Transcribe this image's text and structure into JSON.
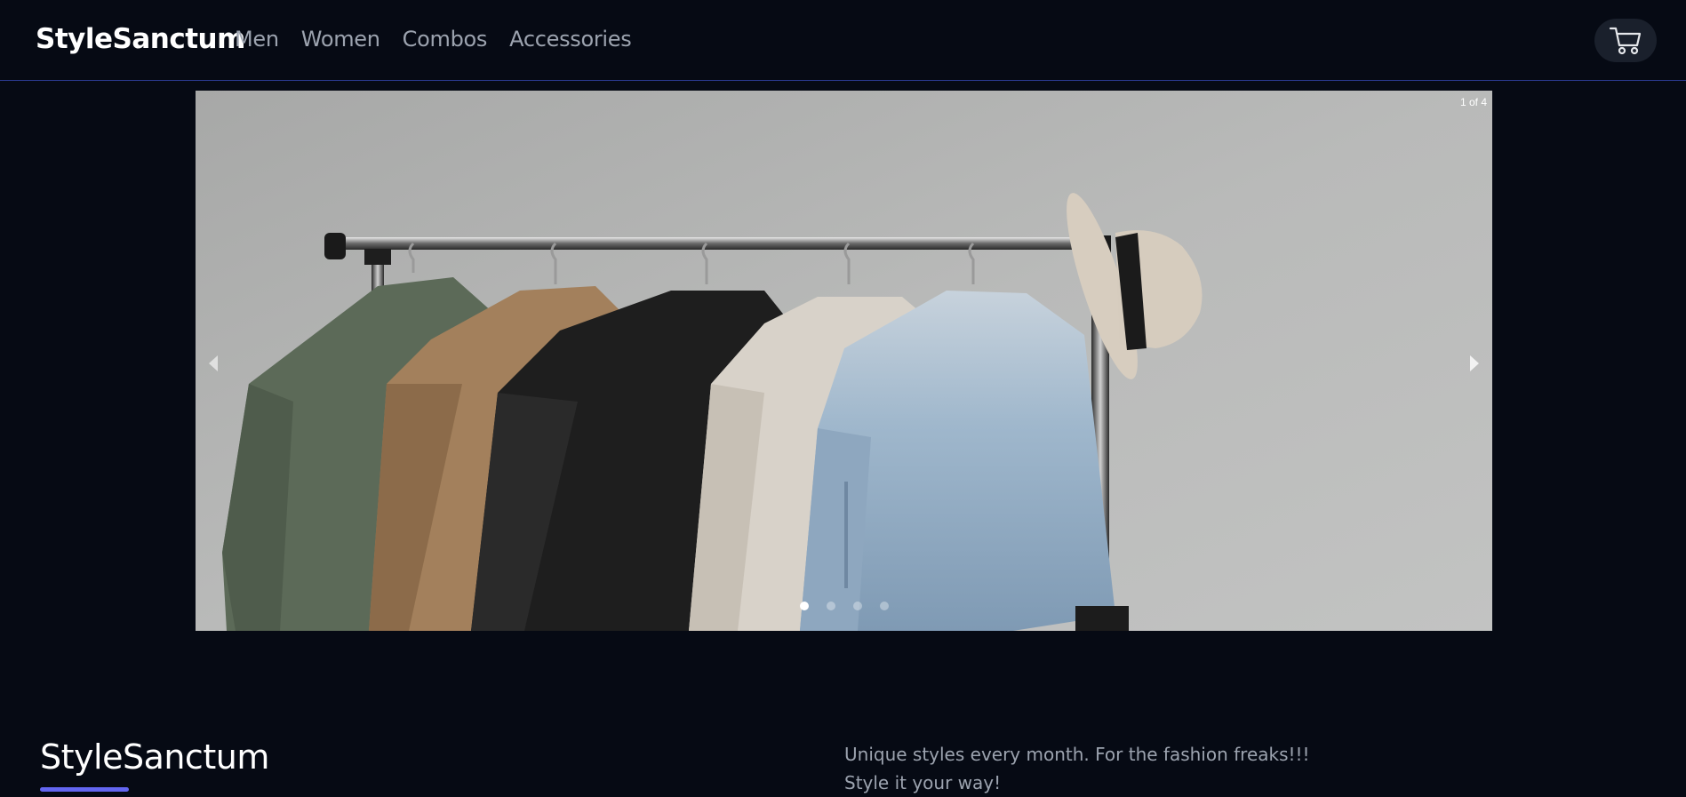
{
  "navbar": {
    "brand": "StyleSanctum",
    "links": [
      {
        "label": "Men"
      },
      {
        "label": "Women"
      },
      {
        "label": "Combos"
      },
      {
        "label": "Accessories"
      }
    ],
    "cart_icon": "cart-icon"
  },
  "carousel": {
    "counter": "1 of 4",
    "current_slide": 1,
    "total_slides": 4,
    "prev_icon": "chevron-left-icon",
    "next_icon": "chevron-right-icon"
  },
  "footer": {
    "brand": "StyleSanctum",
    "tagline_line1": "Unique styles every month. For the fashion freaks!!!",
    "tagline_line2": "Style it your way!",
    "accent_color": "#6366f1"
  },
  "colors": {
    "background": "#060a14",
    "nav_border": "#2b3a8f",
    "nav_link": "#9ca3af",
    "cart_bg": "#1a202c"
  }
}
